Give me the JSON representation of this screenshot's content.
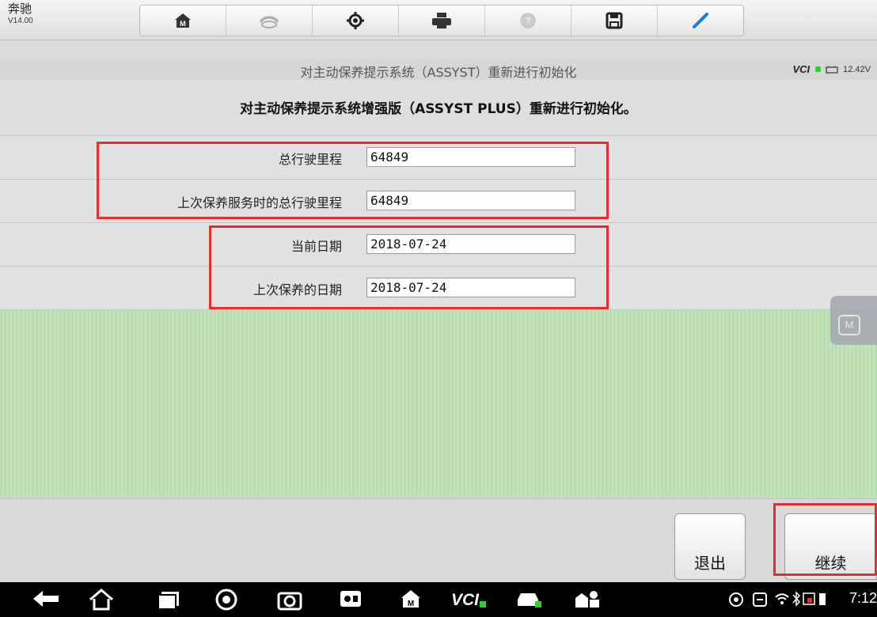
{
  "app": {
    "brand": "奔驰",
    "version": "V14.00"
  },
  "toolbar": [
    "home-icon",
    "car-link-icon",
    "settings-icon",
    "print-icon",
    "help-icon",
    "save-icon",
    "edit-icon"
  ],
  "title": "对主动保养提示系统（ASSYST）重新进行初始化",
  "status": {
    "vci": "VCI",
    "voltage": "12.42V"
  },
  "heading": "对主动保养提示系统增强版（ASSYST PLUS）重新进行初始化。",
  "fields": [
    {
      "label": "总行驶里程",
      "value": "64849"
    },
    {
      "label": "上次保养服务时的总行驶里程",
      "value": "64849"
    },
    {
      "label": "当前日期",
      "value": "2018-07-24"
    },
    {
      "label": "上次保养的日期",
      "value": "2018-07-24"
    }
  ],
  "float_button": "M",
  "buttons": {
    "exit": "退出",
    "continue": "继续"
  },
  "navbar": {
    "time": "7:12"
  },
  "colors": {
    "highlight": "#e03030",
    "green_area": "#bfe2b8"
  }
}
